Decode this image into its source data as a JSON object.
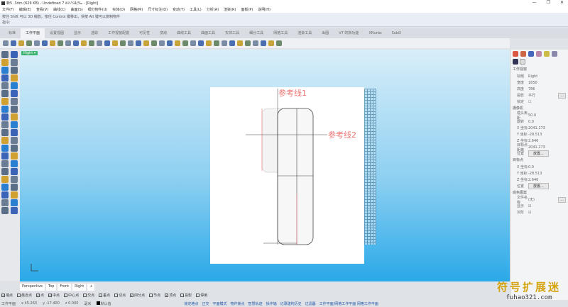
{
  "title": "新5 .3dm (626 KB) - Undefined 7 ä½¼å¦‰ - [Right]",
  "window_buttons": [
    "—",
    "❐",
    "✕"
  ],
  "menu": [
    "文件(F)",
    "编辑(E)",
    "查看(V)",
    "曲线(C)",
    "曲面(S)",
    "细分物件(U)",
    "实体(O)",
    "网格(M)",
    "尺寸标注(D)",
    "变动(T)",
    "工具(L)",
    "分析(A)",
    "渲染(R)",
    "面板(P)",
    "说明(H)"
  ],
  "command": {
    "history": "按住 Shift 可以 3D 缩放，按住 Control 键移出，快按 Alt 键可以复制物件",
    "prompt": "指令:"
  },
  "tabs": [
    "标准",
    "工作平面",
    "设置视图",
    "显示",
    "选取",
    "工作视窗配置",
    "可见性",
    "变动",
    "曲线工具",
    "曲面工具",
    "实体工具",
    "细分工具",
    "网格工具",
    "渲染工具",
    "出图",
    "V7 的新功能",
    "XNurbs",
    "SubD"
  ],
  "active_tab": 1,
  "viewport": {
    "label": "Right ▾",
    "ref1": "参考线1",
    "ref2": "参考线2"
  },
  "viewport_tabs": [
    "Perspective",
    "Top",
    "Front",
    "Right",
    "+"
  ],
  "snaps": [
    {
      "l": "端点",
      "c": true
    },
    {
      "l": "最近点",
      "c": false
    },
    {
      "l": "点",
      "c": true
    },
    {
      "l": "中点",
      "c": true
    },
    {
      "l": "中心点",
      "c": false
    },
    {
      "l": "交点",
      "c": false
    },
    {
      "l": "垂点",
      "c": false
    },
    {
      "l": "切点",
      "c": false
    },
    {
      "l": "四分点",
      "c": true
    },
    {
      "l": "节点",
      "c": false
    },
    {
      "l": "顶点",
      "c": true
    },
    {
      "l": "投影",
      "c": false
    },
    {
      "l": "停用",
      "c": false
    }
  ],
  "status": {
    "cplane": "工作平面",
    "x": "x 45.263",
    "y": "y -17.400",
    "z": "z 0.000",
    "unit": "毫米",
    "layer": "默认值",
    "toggles": [
      "锁定格点",
      "正交",
      "平面模式",
      "物件锁点",
      "智慧轨迹",
      "操作轴",
      "记录建构历史",
      "过滤器",
      "工作平面/网格工作平面 网格工作平面"
    ]
  },
  "panel": {
    "viewport_section": "工作视窗",
    "viewport": [
      [
        "标题",
        "Right"
      ],
      [
        "宽度",
        "1650"
      ],
      [
        "高度",
        "786"
      ],
      [
        "投影",
        "平行"
      ],
      [
        "锁定",
        "☐"
      ]
    ],
    "camera_section": "摄像机",
    "camera": [
      [
        "镜头焦距",
        "50.0"
      ],
      [
        "旋转",
        "0.0"
      ],
      [
        "X 坐标",
        "2041.273"
      ],
      [
        "Y 坐标",
        "-28.513"
      ],
      [
        "Z 坐标",
        "2.646"
      ],
      [
        "目标点距离",
        "2041.273"
      ]
    ],
    "place_label": "位置",
    "place_button": "放置...",
    "target_section": "目标点",
    "target": [
      [
        "X 坐标",
        "0.0"
      ],
      [
        "Y 坐标",
        "-28.513"
      ],
      [
        "Z 坐标",
        "2.646"
      ]
    ],
    "bg_section": "底色图案",
    "bg": [
      [
        "文件名称",
        "(无)"
      ],
      [
        "显示",
        "☑"
      ],
      [
        "灰阶",
        "☑"
      ]
    ],
    "dots": "..."
  },
  "watermark": {
    "line1": "符号扩展迷",
    "line2": "fuhao321.com"
  }
}
